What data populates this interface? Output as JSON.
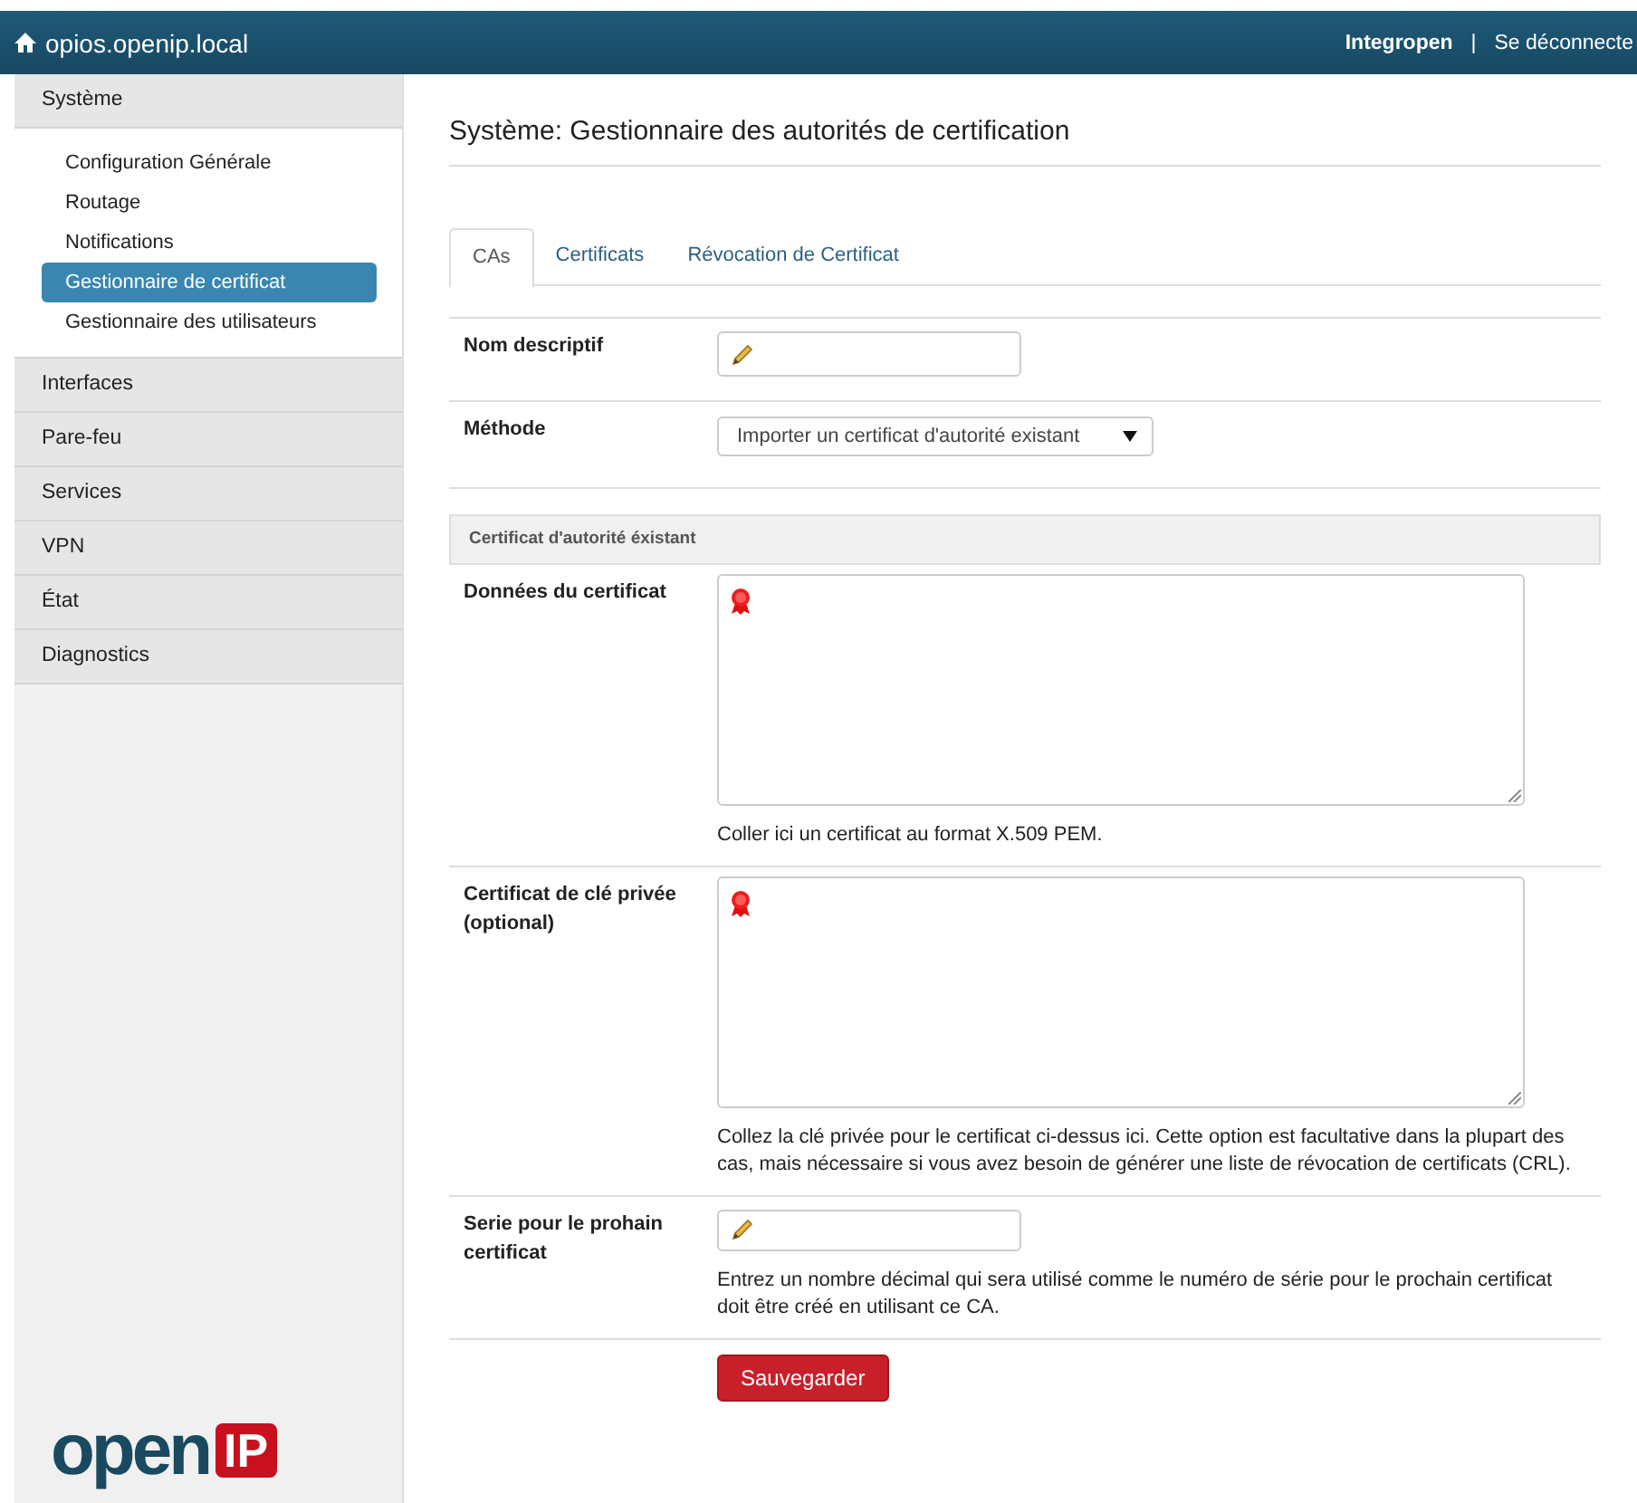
{
  "topbar": {
    "title": "opios.openip.local",
    "user": "Integropen",
    "separator": "|",
    "logout": "Se déconnecte"
  },
  "sidebar": {
    "sections": [
      {
        "label": "Système",
        "children": [
          {
            "label": "Configuration Générale",
            "selected": false
          },
          {
            "label": "Routage",
            "selected": false
          },
          {
            "label": "Notifications",
            "selected": false
          },
          {
            "label": "Gestionnaire de certificat",
            "selected": true
          },
          {
            "label": "Gestionnaire des utilisateurs",
            "selected": false
          }
        ]
      },
      {
        "label": "Interfaces"
      },
      {
        "label": "Pare-feu"
      },
      {
        "label": "Services"
      },
      {
        "label": "VPN"
      },
      {
        "label": "État"
      },
      {
        "label": "Diagnostics"
      }
    ],
    "logo": {
      "part_1": "open",
      "part_2": "IP"
    }
  },
  "page_title": "Système: Gestionnaire des autorités de certification",
  "tabs": [
    {
      "label": "CAs",
      "selected": true
    },
    {
      "label": "Certificats",
      "selected": false
    },
    {
      "label": "Révocation de Certificat",
      "selected": false
    }
  ],
  "form": [
    {
      "kind": "text",
      "label": "Nom descriptif"
    },
    {
      "kind": "select",
      "label": "Méthode",
      "value": "Importer un certificat d'autorité existant"
    },
    {
      "kind": "section",
      "label": "Certificat d'autorité éxistant"
    },
    {
      "kind": "textarea",
      "label": "Données du certificat",
      "help": "Coller ici un certificat au format X.509 PEM."
    },
    {
      "kind": "textarea",
      "label": "Certificat de clé privée",
      "note": "(optional)",
      "help": "Collez la clé privée pour le certificat ci-dessus ici. Cette option est facultative dans la plupart des cas, mais nécessaire si vous avez besoin de générer une liste de révocation de certificats (CRL)."
    },
    {
      "kind": "short",
      "label": "Serie pour le prohain certificat",
      "help": "Entrez un nombre décimal qui sera utilisé comme le numéro de série pour le prochain certificat doit être créé en utilisant ce CA."
    }
  ],
  "save_button": "Sauvegarder"
}
